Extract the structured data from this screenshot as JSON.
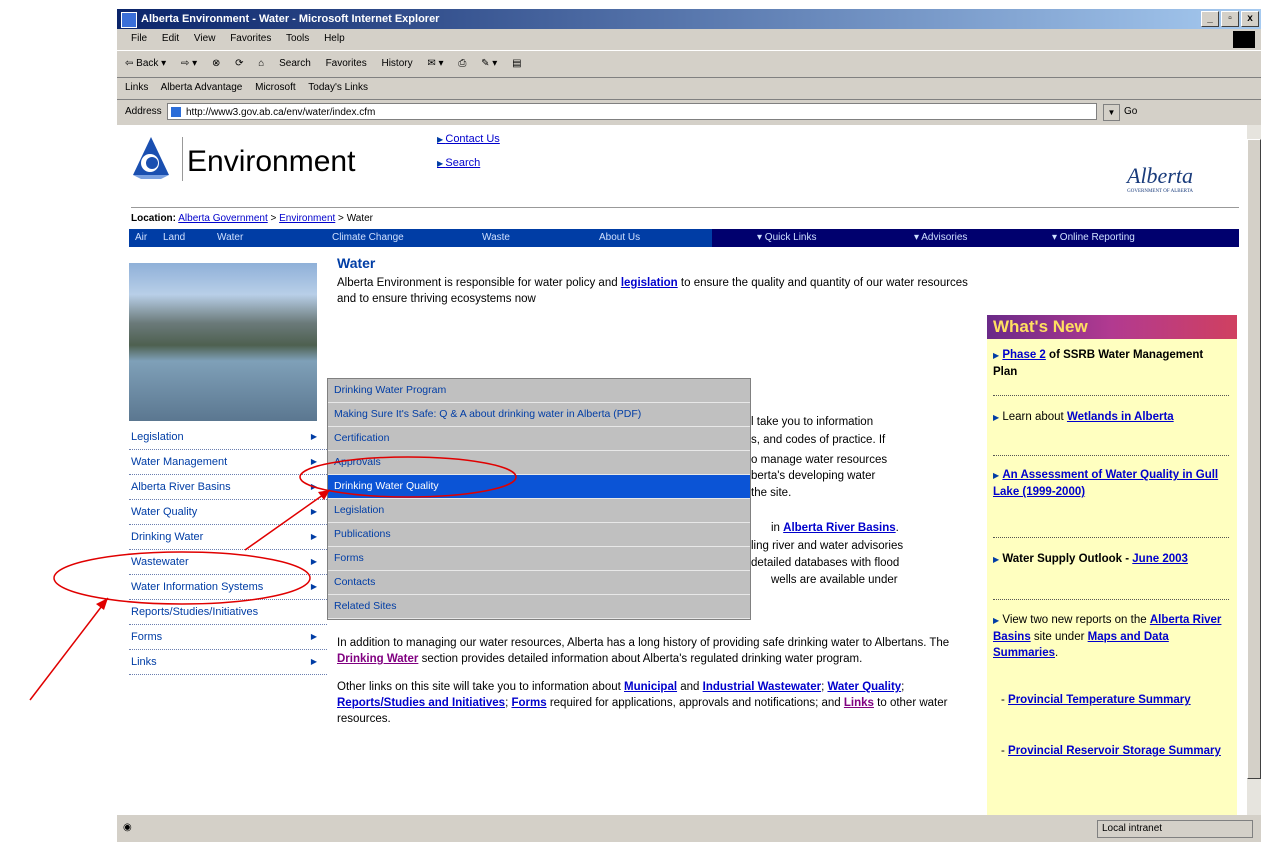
{
  "browser": {
    "title": "Alberta Environment - Water - Microsoft Internet Explorer",
    "window_buttons": [
      "_",
      "▫",
      "x"
    ],
    "menu": [
      "File",
      "Edit",
      "View",
      "Favorites",
      "Tools",
      "Help"
    ],
    "toolbar": [
      "⇦ Back ▾",
      "⇨ ▾",
      "⊗",
      "⟳",
      "⌂",
      "Search",
      "Favorites",
      "History",
      "✉ ▾",
      "⎙",
      "✎ ▾",
      "▤"
    ],
    "links_label": "Links",
    "links": [
      "Alberta Advantage",
      "Microsoft",
      "Today's Links"
    ],
    "address_label": "Address",
    "address": "http://www3.gov.ab.ca/env/water/index.cfm",
    "go": "Go",
    "status_zone": "Local intranet"
  },
  "page": {
    "site_title": "Environment",
    "top_links": [
      "Contact Us",
      "Search"
    ],
    "alberta_logo": "Alberta",
    "alberta_sub": "GOVERNMENT OF ALBERTA",
    "location_label": "Location:",
    "breadcrumb": [
      "Alberta Government",
      "Environment",
      "Water"
    ],
    "nav": [
      "Air",
      "Land",
      "Water",
      "Climate Change",
      "Waste",
      "About Us",
      "▾ Quick Links",
      "▾ Advisories",
      "▾ Online Reporting"
    ],
    "left_nav": [
      "Legislation",
      "Water Management",
      "Alberta River Basins",
      "Water Quality",
      "Drinking Water",
      "Wastewater",
      "Water Information Systems",
      "Reports/Studies/Initiatives",
      "Forms",
      "Links"
    ],
    "heading": "Water",
    "p1_a": "Alberta Environment is responsible for water policy and",
    "p1_link": "legislation",
    "p1_b": "to ensure the quality and quantity of our water resources and to ensure thriving ecosystems now",
    "frag1": "l take you to information",
    "frag2": "s, and codes of practice. If",
    "frag3": "o manage water resources",
    "frag4": "berta's developing water",
    "frag5": "the site.",
    "frag6_a": "in",
    "frag6_link": "Alberta River Basins",
    "frag6_b": ".",
    "frag7": "ling river and water advisories",
    "frag8": "detailed databases with flood",
    "frag9": "wells are available under",
    "p3_a": "In addition to managing our water resources, Alberta has a long history of providing safe drinking water to Albertans. The",
    "p3_link": "Drinking Water",
    "p3_b": "section provides detailed information about Alberta's regulated drinking water program.",
    "p4_a": "Other links on this site will take you to information about",
    "p4_l1": "Municipal",
    "p4_b": "and",
    "p4_l2": "Industrial Wastewater",
    "p4_l3": "Water Quality",
    "p4_l4": "Reports/Studies and Initiatives",
    "p4_l5": "Forms",
    "p4_c": "required for applications, approvals and notifications; and",
    "p4_l6": "Links",
    "p4_d": "to other water resources.",
    "dropdown": [
      "Drinking Water Program",
      "Making Sure It's Safe: Q & A about drinking water in Alberta (PDF)",
      "Certification",
      "Approvals",
      "Drinking Water Quality",
      "Legislation",
      "Publications",
      "Forms",
      "Contacts",
      "Related Sites"
    ],
    "whats_new": {
      "header": "What's New",
      "i1_link": "Phase 2",
      "i1_text": "of SSRB Water Management Plan",
      "i2_text": "Learn about",
      "i2_link": "Wetlands in Alberta",
      "i3_link": "An Assessment of Water Quality in Gull Lake (1999-2000)",
      "i4_text": "Water Supply Outlook -",
      "i4_link": "June 2003",
      "i5_text": "View two new reports on the",
      "i5_link": "Alberta River Basins",
      "i5_text2": "site under",
      "i5_link2": "Maps and Data Summaries",
      "i6_link": "Provincial Temperature Summary",
      "i7_link": "Provincial Reservoir Storage Summary"
    }
  },
  "colors": {
    "annotation": "#e00000",
    "nav_blue": "#003da5",
    "menu_highlight": "#0b54d6",
    "whats_new_bg": "#ffffc0"
  }
}
